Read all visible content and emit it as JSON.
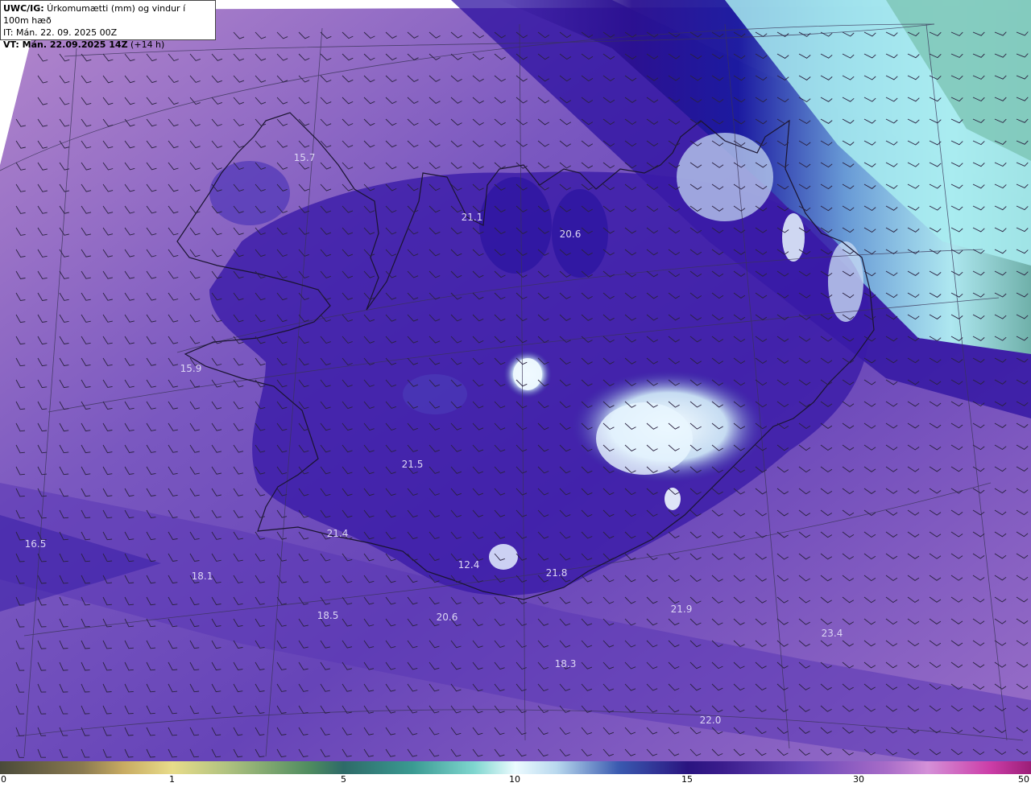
{
  "info": {
    "title_bold": "UWC/IG:",
    "title_text": " Úrkomumætti (mm) og vindur í 100m hæð",
    "issue_time": "IT: Mán. 22. 09. 2025 00Z",
    "valid_bold": "VT: Mán. 22.09.2025 14Z",
    "valid_offset": " (+14 h)"
  },
  "labels": [
    "15.7",
    "21.1",
    "20.6",
    "15.9",
    "21.5",
    "21.4",
    "16.5",
    "18.1",
    "18.5",
    "20.6",
    "12.4",
    "21.8",
    "21.9",
    "23.4",
    "18.3",
    "22.0"
  ],
  "colorbar": {
    "ticks": [
      "0",
      "1",
      "5",
      "10",
      "15",
      "30",
      "50"
    ]
  },
  "colors": {
    "land_outline": "#1a1430",
    "barb": "#2a2240",
    "graticule": "#3a3458"
  }
}
